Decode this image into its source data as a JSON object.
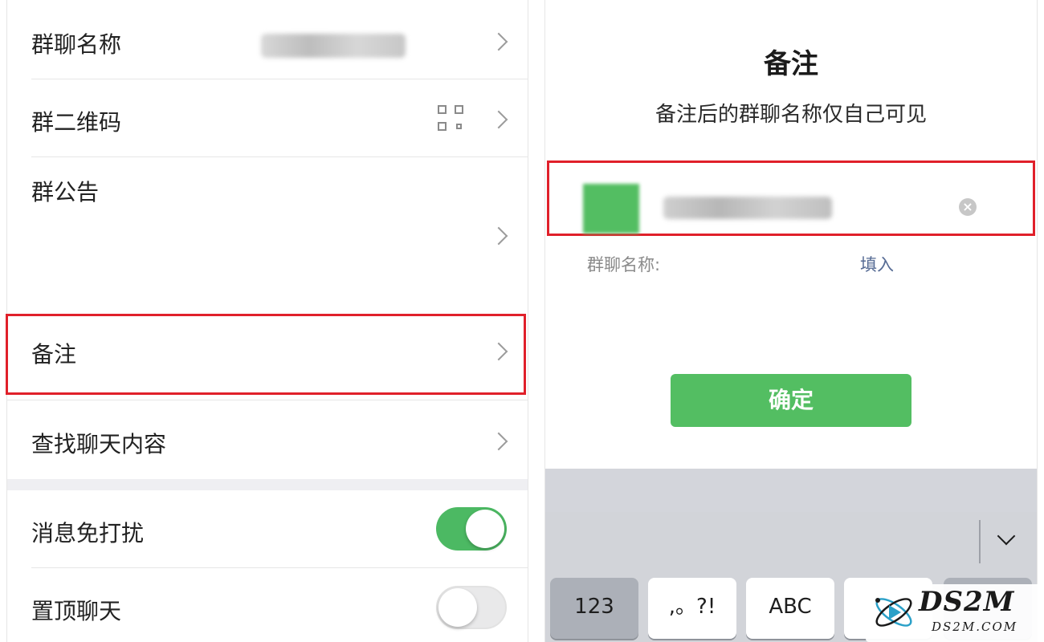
{
  "left_panel": {
    "rows": {
      "group_name": {
        "label": "群聊名称"
      },
      "group_qr": {
        "label": "群二维码"
      },
      "announcement": {
        "label": "群公告"
      },
      "remark": {
        "label": "备注"
      },
      "search_history": {
        "label": "查找聊天内容"
      },
      "mute": {
        "label": "消息免打扰",
        "toggle_on": true
      },
      "sticky": {
        "label": "置顶聊天",
        "toggle_on": false
      }
    },
    "colors": {
      "toggle_on": "#4cb963",
      "highlight": "#e0202a"
    }
  },
  "remark_dialog": {
    "title": "备注",
    "subtitle": "备注后的群聊名称仅自己可见",
    "group_name_label": "群聊名称:",
    "fill_link": "填入",
    "confirm_button": "确定",
    "colors": {
      "confirm": "#53be62",
      "link": "#566b94"
    }
  },
  "keyboard": {
    "keys": [
      "123",
      ",。?!",
      "ABC"
    ]
  },
  "watermark": {
    "main": "DS2M",
    "sub": "DS2M.COM"
  }
}
